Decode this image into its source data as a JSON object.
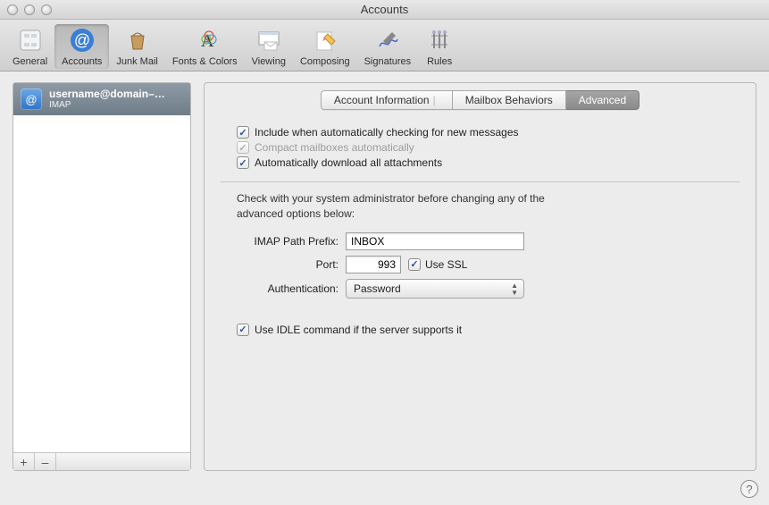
{
  "window": {
    "title": "Accounts"
  },
  "toolbar": [
    {
      "id": "general",
      "label": "General"
    },
    {
      "id": "accounts",
      "label": "Accounts",
      "selected": true
    },
    {
      "id": "junk",
      "label": "Junk Mail"
    },
    {
      "id": "fonts",
      "label": "Fonts & Colors"
    },
    {
      "id": "viewing",
      "label": "Viewing"
    },
    {
      "id": "composing",
      "label": "Composing"
    },
    {
      "id": "signatures",
      "label": "Signatures"
    },
    {
      "id": "rules",
      "label": "Rules"
    }
  ],
  "sidebar": {
    "accounts": [
      {
        "name": "username@domain–…",
        "type": "IMAP"
      }
    ],
    "add": "+",
    "remove": "–"
  },
  "tabs": {
    "info": "Account Information",
    "behaviors": "Mailbox Behaviors",
    "advanced": "Advanced"
  },
  "checks": {
    "include": "Include when automatically checking for new messages",
    "compact": "Compact mailboxes automatically",
    "download": "Automatically download all attachments",
    "idle": "Use IDLE command if the server supports it",
    "usessl": "Use SSL"
  },
  "hint": "Check with your system administrator before changing any of the advanced options below:",
  "form": {
    "prefix_label": "IMAP Path Prefix:",
    "prefix_value": "INBOX",
    "port_label": "Port:",
    "port_value": "993",
    "auth_label": "Authentication:",
    "auth_value": "Password"
  },
  "checkmark": "✓",
  "help": "?"
}
